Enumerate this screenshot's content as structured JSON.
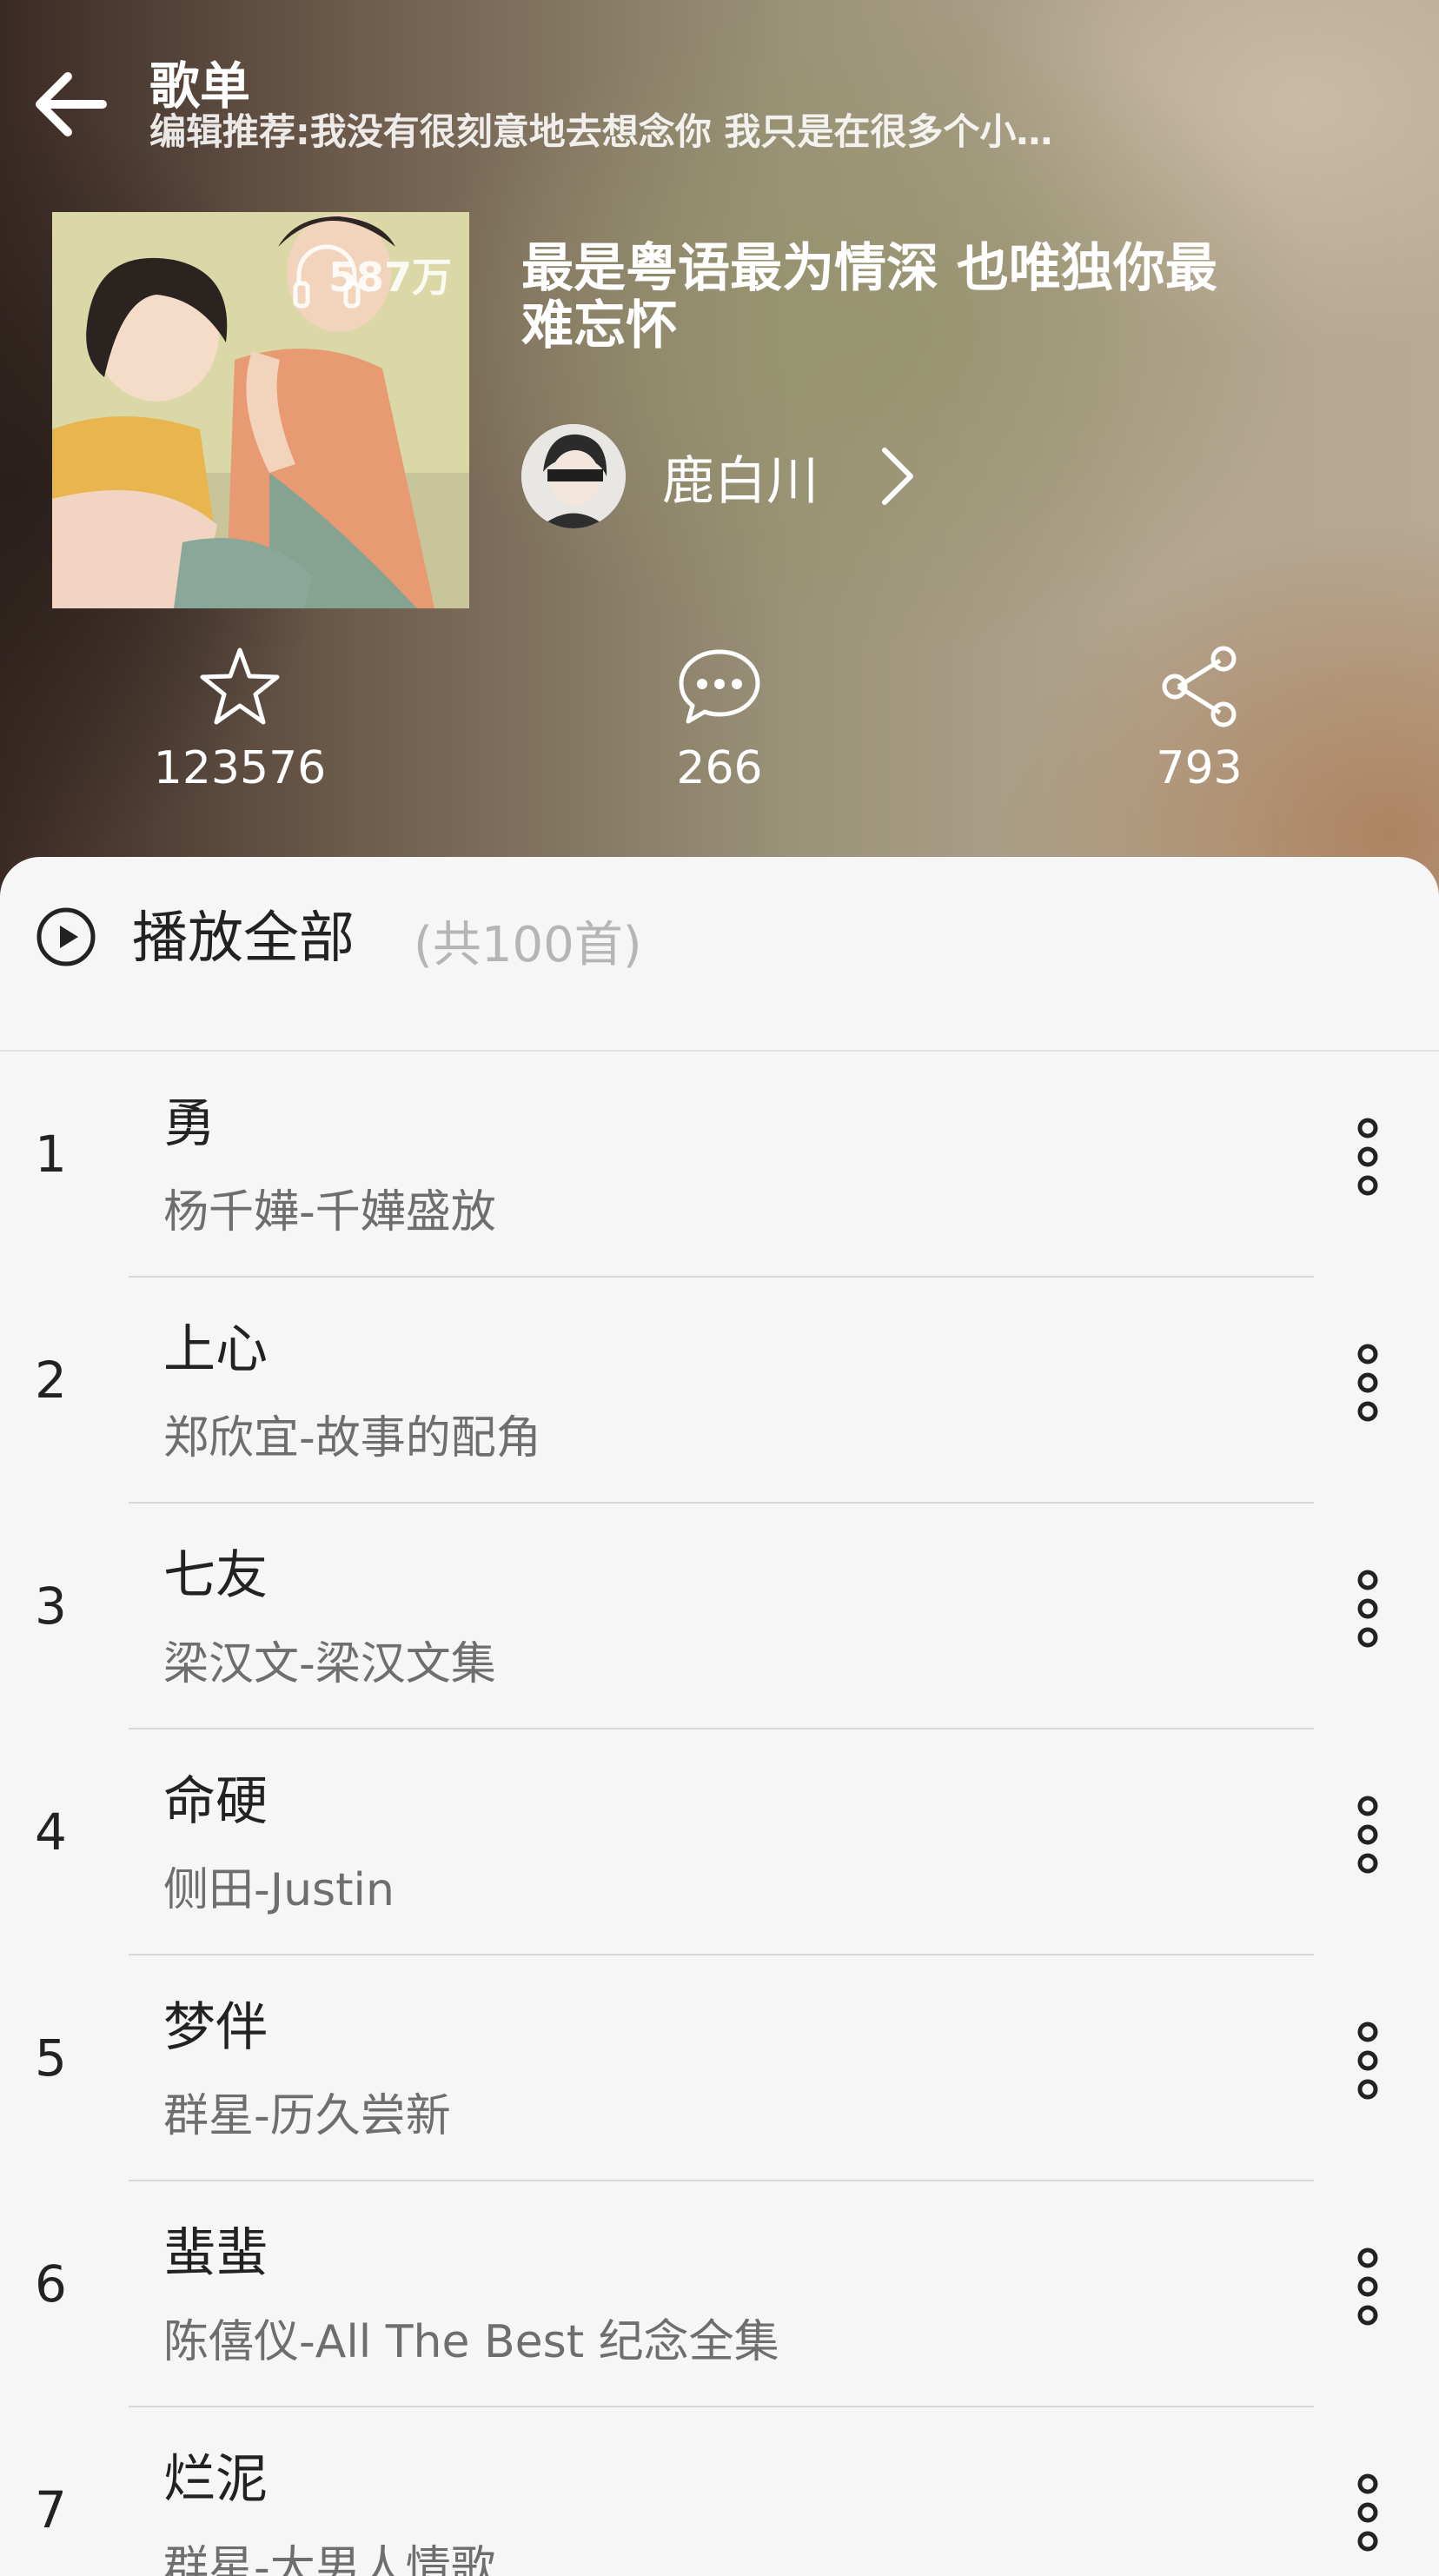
{
  "header": {
    "title": "歌单",
    "subtitle": "编辑推荐:我没有很刻意地去想念你 我只是在很多个小…"
  },
  "playlist": {
    "play_count": "587万",
    "name": "最是粤语最为情深 也唯独你最难忘怀",
    "creator": "鹿白川"
  },
  "stats": {
    "favorite": "123576",
    "comment": "266",
    "share": "793"
  },
  "play_all": {
    "label": "播放全部",
    "count": "(共100首)"
  },
  "songs": [
    {
      "index": "1",
      "title": "勇",
      "meta": "杨千嬅-千嬅盛放"
    },
    {
      "index": "2",
      "title": "上心",
      "meta": "郑欣宜-故事的配角"
    },
    {
      "index": "3",
      "title": "七友",
      "meta": "梁汉文-梁汉文集"
    },
    {
      "index": "4",
      "title": "命硬",
      "meta": "侧田-Justin"
    },
    {
      "index": "5",
      "title": "梦伴",
      "meta": "群星-历久尝新"
    },
    {
      "index": "6",
      "title": "蜚蜚",
      "meta": "陈僖仪-All The Best 纪念全集"
    },
    {
      "index": "7",
      "title": "烂泥",
      "meta": "群星-大男人情歌"
    }
  ],
  "icons": {
    "back": "arrow-left",
    "favorite": "star-outline",
    "comment": "speech-bubble",
    "share": "share-nodes",
    "play_all": "play-circle",
    "more": "vertical-dots",
    "creator_link": "chevron-right",
    "play_count": "headphones"
  },
  "colors": {
    "text_primary": "#222222",
    "text_secondary": "#6e6e6e",
    "count_muted": "#b5b5b5",
    "card_bg": "#f6f6f6"
  }
}
